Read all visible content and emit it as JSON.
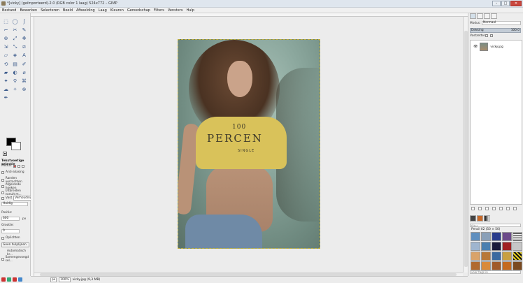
{
  "window": {
    "title": "*[vicky] (geïmporteerd)-2.0 (RGB color 1 laag) 524x772 – GIMP",
    "minimize": "–",
    "maximize": "□",
    "close": "✕"
  },
  "menu": [
    "Bestand",
    "Bewerken",
    "Selecteren",
    "Beeld",
    "Afbeelding",
    "Laag",
    "Kleuren",
    "Gereedschap",
    "Filters",
    "Vensters",
    "Hulp"
  ],
  "tools": [
    "⬚",
    "◯",
    "ʃ",
    "⌐",
    "✂",
    "✎",
    "⊕",
    "⤢",
    "✥",
    "⇲",
    "⤡",
    "⧄",
    "▱",
    "◈",
    "A",
    "⟲",
    "▤",
    "✐",
    "▰",
    "◐",
    "⌀",
    "✦",
    "⚲",
    "⌘",
    "☁",
    "✧",
    "⊗",
    "✒"
  ],
  "tool_options": {
    "title": "Tekstvoetige selectie",
    "mode_label": "Modus:",
    "antialias_label": "Anti-aliasing",
    "feather_label": "Randen verzachten",
    "rounded_label": "Afgeronde hoeken",
    "expand_label": "Uitbreiden vanuit m...",
    "fixed_label": "Vast",
    "fixed_value": "Verhouding",
    "current_label": "Huidig",
    "position_label": "Positie:",
    "position_value": "600",
    "position_unit": "px",
    "size_label": "Grootte:",
    "size_value": "0",
    "highlight_label": "Oplichten",
    "guides_value": "Geen hulplijnen",
    "auto_shrink_label": "Automatisch kr...",
    "merged_label": "Samengevoegd sel..."
  },
  "layers_panel": {
    "mode_label": "Modus:",
    "mode_value": "Normaal",
    "opacity_label": "Dekking",
    "opacity_value": "100.0",
    "lock_label": "Vastzetten:",
    "layer_name": "vicky.jpg"
  },
  "brushes_panel": {
    "filter_placeholder": "filter",
    "info": "Pencil 02 (50 × 50)",
    "tags_placeholder": "voer tags in"
  },
  "status": {
    "unit": "px",
    "zoom": "100%",
    "info": "vicky.jpg (9,3 MB)"
  },
  "photo_text": {
    "line1": "100",
    "line2": "PERCEN",
    "line3": "SINGLE"
  },
  "colors": {
    "foreground": "#000000",
    "background": "#ffffff",
    "selection": "#bfae3a"
  }
}
